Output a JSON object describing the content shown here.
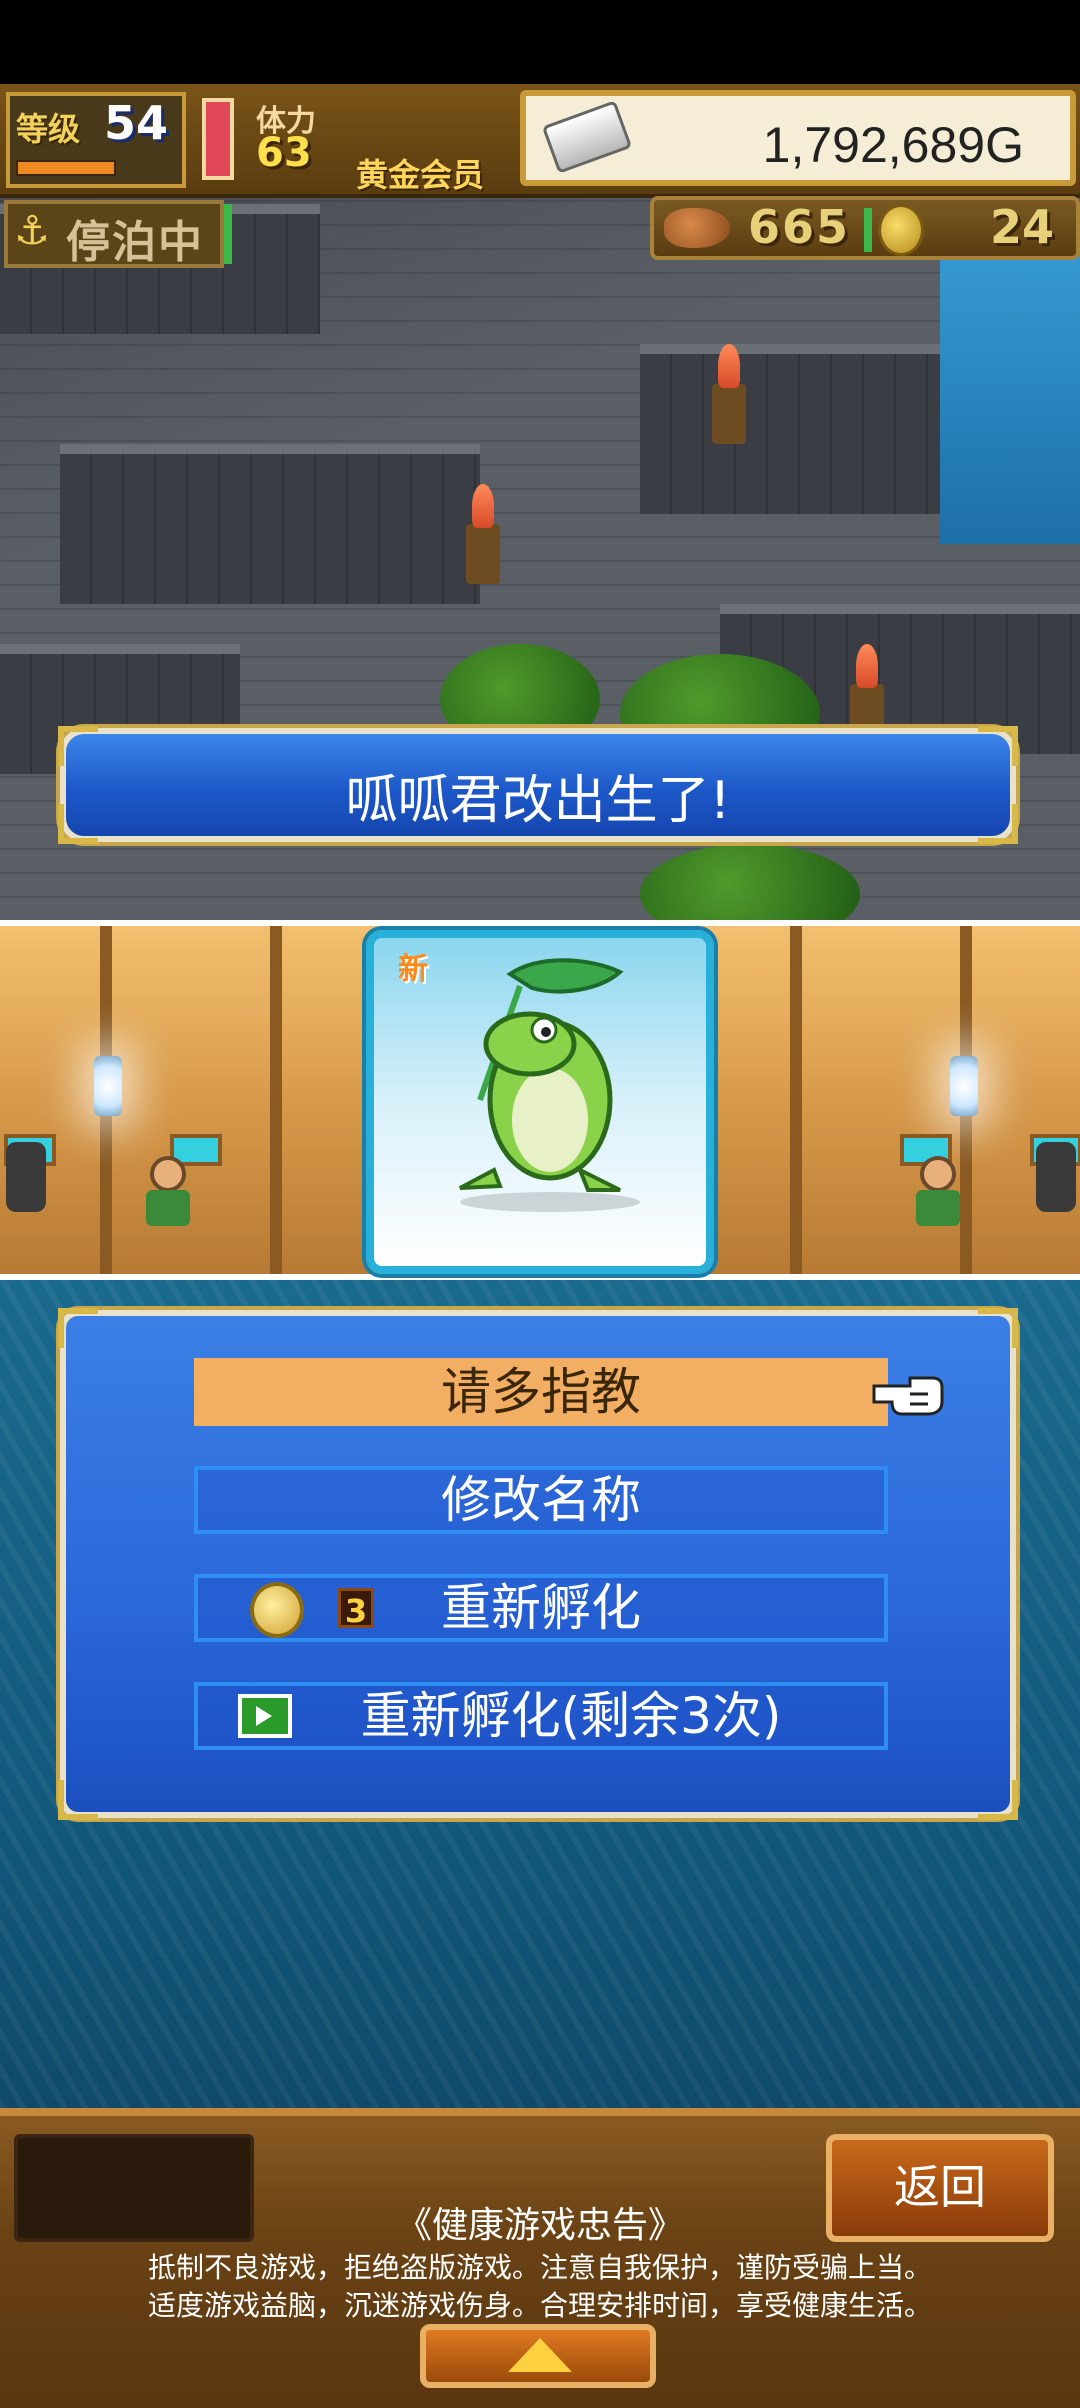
{
  "hud": {
    "level_label": "等级",
    "level_value": "54",
    "stamina_label": "体力",
    "stamina_value": "63",
    "member_label": "黄金会员",
    "gold": "1,792,689G",
    "anchor_label": "停泊中",
    "food_count": "665",
    "coin_count": "24"
  },
  "banner": {
    "text": "呱呱君改出生了!"
  },
  "card": {
    "badge": "新",
    "creature": "frog-icon"
  },
  "menu": {
    "items": [
      {
        "label": "请多指教"
      },
      {
        "label": "修改名称"
      },
      {
        "label": "重新孵化",
        "cost": "3",
        "icon": "coin-icon"
      },
      {
        "label": "重新孵化(剩余3次)",
        "icon": "video-play-icon"
      }
    ]
  },
  "bottom": {
    "back_label": "返回",
    "notice_title": "《健康游戏忠告》",
    "notice_line_1": "抵制不良游戏，拒绝盗版游戏。注意自我保护，谨防受骗上当。",
    "notice_line_2": "适度游戏益脑，沉迷游戏伤身。合理安排时间，享受健康生活。"
  },
  "colors": {
    "menu_highlight": "#f2ae62",
    "menu_panel": "#2a67d8",
    "banner": "#1d58c8",
    "card_border": "#29b0d8"
  }
}
